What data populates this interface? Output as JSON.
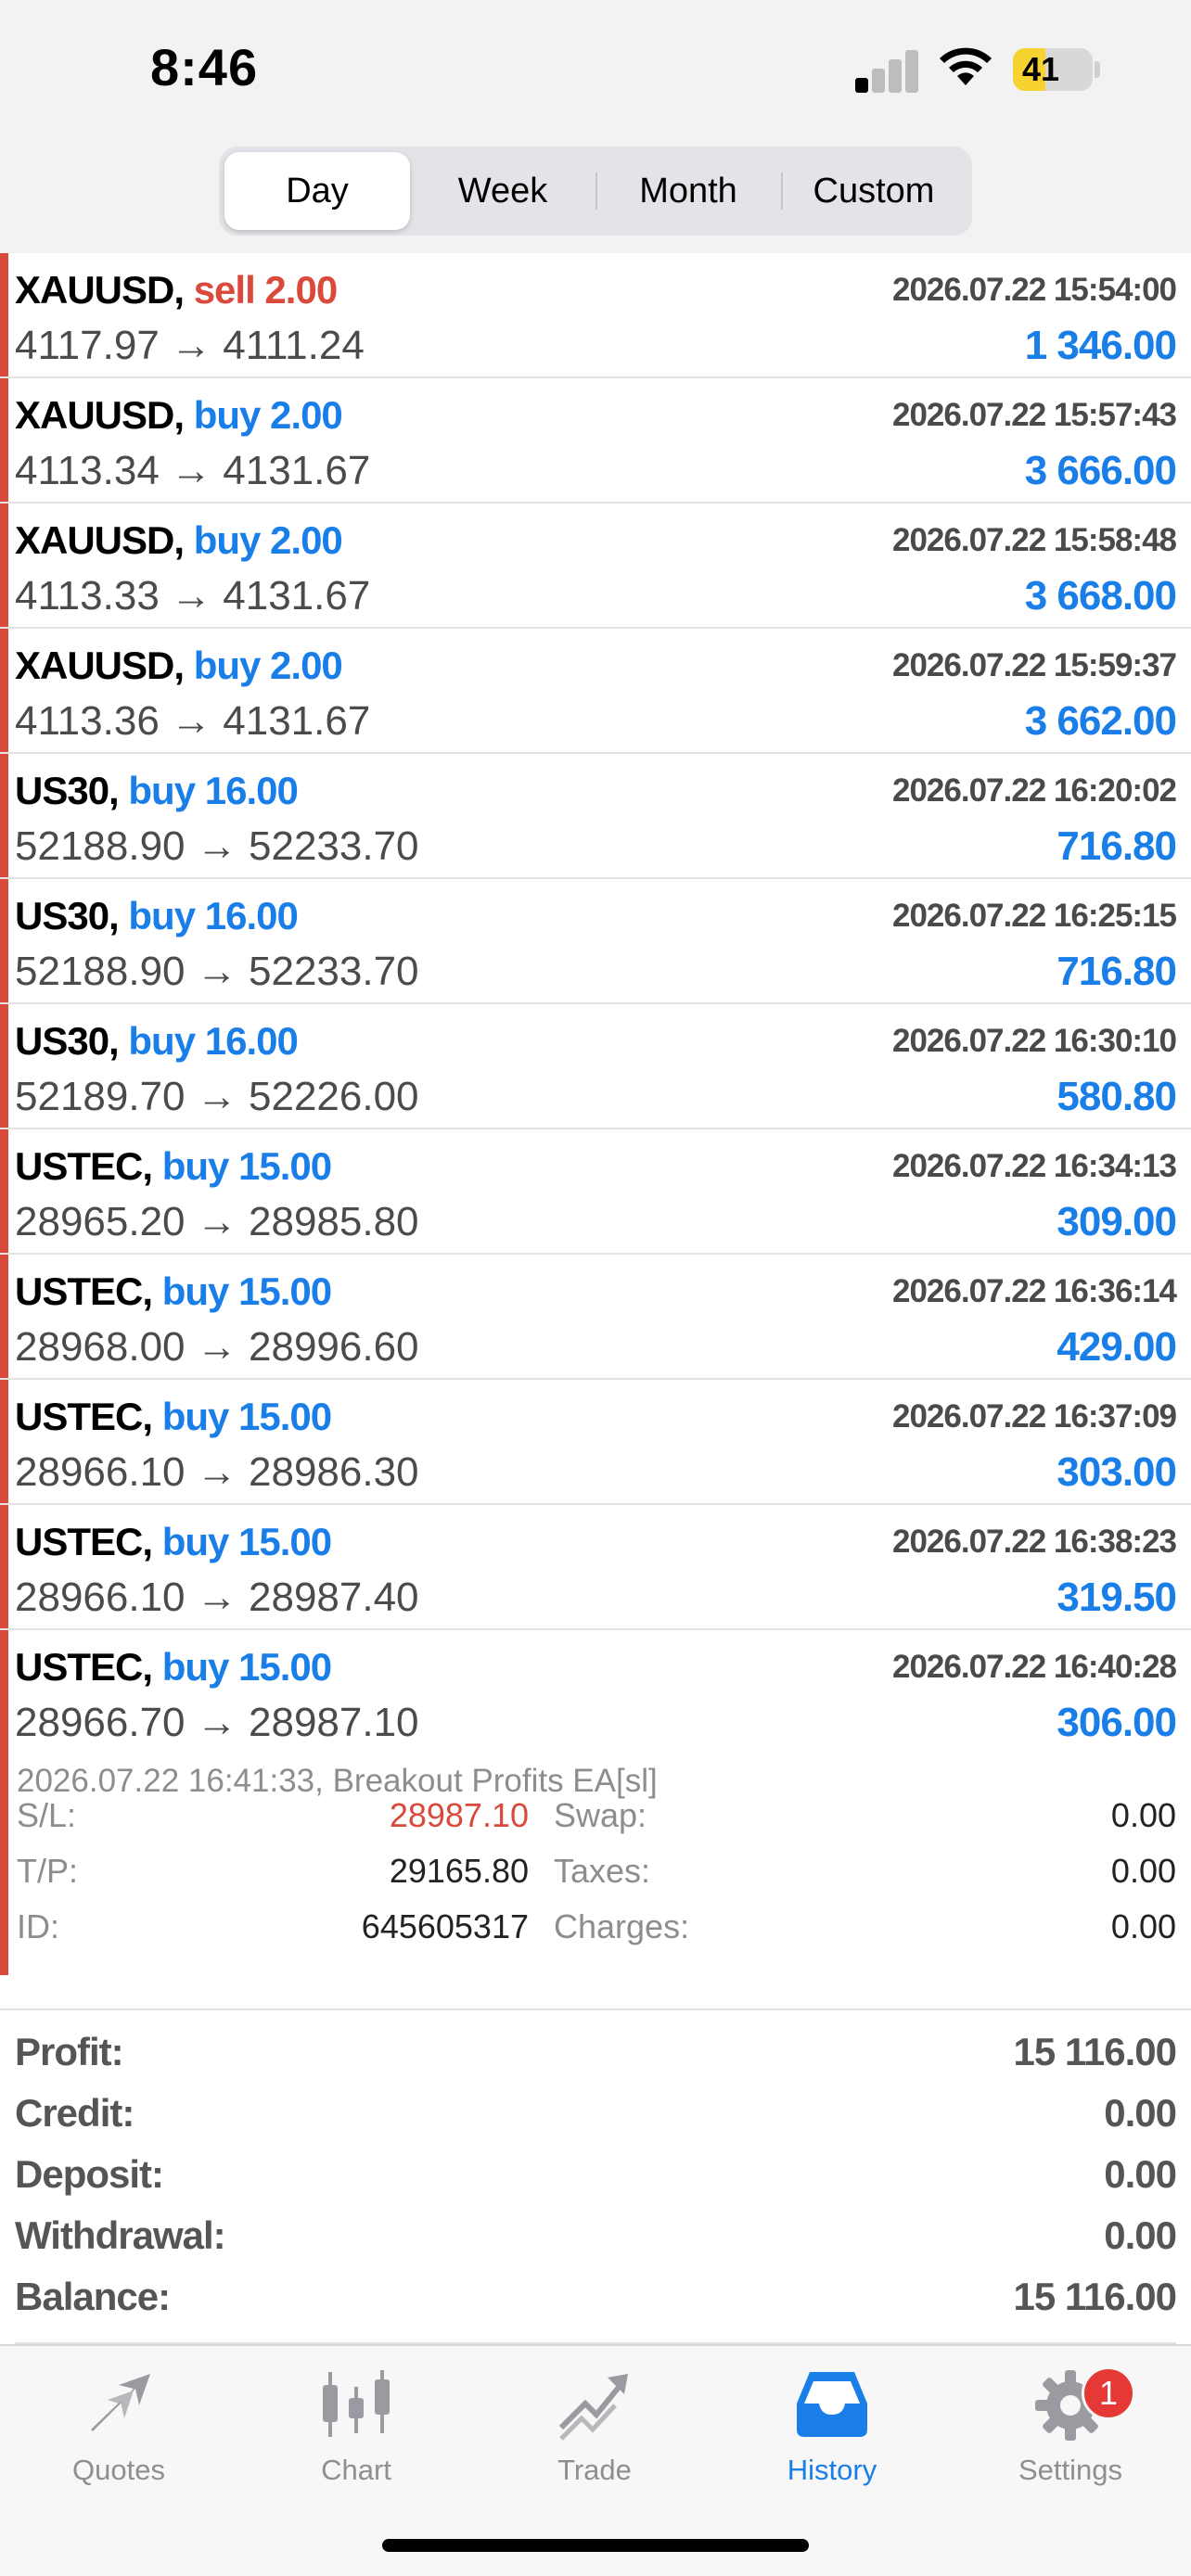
{
  "status_bar": {
    "time": "8:46",
    "battery_level": "41",
    "battery_fraction": 0.41,
    "signal_bars_active": 1,
    "signal_bars_total": 4
  },
  "period_tabs": [
    {
      "label": "Day",
      "active": true
    },
    {
      "label": "Week",
      "active": false
    },
    {
      "label": "Month",
      "active": false
    },
    {
      "label": "Custom",
      "active": false
    }
  ],
  "colors": {
    "buy": "#1a7ee8",
    "sell": "#d94a3c",
    "accent": "#1a7ee8",
    "badge": "#e53935"
  },
  "trades": [
    {
      "symbol": "XAUUSD,",
      "side": "sell 2.00",
      "side_type": "sell",
      "time": "2026.07.22 15:54:00",
      "open": "4117.97",
      "close": "4111.24",
      "profit": "1 346.00"
    },
    {
      "symbol": "XAUUSD,",
      "side": "buy 2.00",
      "side_type": "buy",
      "time": "2026.07.22 15:57:43",
      "open": "4113.34",
      "close": "4131.67",
      "profit": "3 666.00"
    },
    {
      "symbol": "XAUUSD,",
      "side": "buy 2.00",
      "side_type": "buy",
      "time": "2026.07.22 15:58:48",
      "open": "4113.33",
      "close": "4131.67",
      "profit": "3 668.00"
    },
    {
      "symbol": "XAUUSD,",
      "side": "buy 2.00",
      "side_type": "buy",
      "time": "2026.07.22 15:59:37",
      "open": "4113.36",
      "close": "4131.67",
      "profit": "3 662.00"
    },
    {
      "symbol": "US30,",
      "side": "buy 16.00",
      "side_type": "buy",
      "time": "2026.07.22 16:20:02",
      "open": "52188.90",
      "close": "52233.70",
      "profit": "716.80"
    },
    {
      "symbol": "US30,",
      "side": "buy 16.00",
      "side_type": "buy",
      "time": "2026.07.22 16:25:15",
      "open": "52188.90",
      "close": "52233.70",
      "profit": "716.80"
    },
    {
      "symbol": "US30,",
      "side": "buy 16.00",
      "side_type": "buy",
      "time": "2026.07.22 16:30:10",
      "open": "52189.70",
      "close": "52226.00",
      "profit": "580.80"
    },
    {
      "symbol": "USTEC,",
      "side": "buy 15.00",
      "side_type": "buy",
      "time": "2026.07.22 16:34:13",
      "open": "28965.20",
      "close": "28985.80",
      "profit": "309.00"
    },
    {
      "symbol": "USTEC,",
      "side": "buy 15.00",
      "side_type": "buy",
      "time": "2026.07.22 16:36:14",
      "open": "28968.00",
      "close": "28996.60",
      "profit": "429.00"
    },
    {
      "symbol": "USTEC,",
      "side": "buy 15.00",
      "side_type": "buy",
      "time": "2026.07.22 16:37:09",
      "open": "28966.10",
      "close": "28986.30",
      "profit": "303.00"
    },
    {
      "symbol": "USTEC,",
      "side": "buy 15.00",
      "side_type": "buy",
      "time": "2026.07.22 16:38:23",
      "open": "28966.10",
      "close": "28987.40",
      "profit": "319.50"
    },
    {
      "symbol": "USTEC,",
      "side": "buy 15.00",
      "side_type": "buy",
      "time": "2026.07.22 16:40:28",
      "open": "28966.70",
      "close": "28987.10",
      "profit": "306.00"
    }
  ],
  "arrow": "→",
  "expanded_detail": {
    "comment": "2026.07.22 16:41:33, Breakout Profits EA[sl]",
    "left": [
      {
        "label": "S/L:",
        "value": "28987.10",
        "highlight": true
      },
      {
        "label": "T/P:",
        "value": "29165.80",
        "highlight": false
      },
      {
        "label": "ID:",
        "value": "645605317",
        "highlight": false
      }
    ],
    "right": [
      {
        "label": "Swap:",
        "value": "0.00"
      },
      {
        "label": "Taxes:",
        "value": "0.00"
      },
      {
        "label": "Charges:",
        "value": "0.00"
      }
    ]
  },
  "summary": [
    {
      "label": "Profit:",
      "value": "15 116.00"
    },
    {
      "label": "Credit:",
      "value": "0.00"
    },
    {
      "label": "Deposit:",
      "value": "0.00"
    },
    {
      "label": "Withdrawal:",
      "value": "0.00"
    },
    {
      "label": "Balance:",
      "value": "15 116.00"
    }
  ],
  "tabbar": [
    {
      "label": "Quotes",
      "icon": "quotes-icon",
      "active": false
    },
    {
      "label": "Chart",
      "icon": "chart-icon",
      "active": false
    },
    {
      "label": "Trade",
      "icon": "trade-icon",
      "active": false
    },
    {
      "label": "History",
      "icon": "history-icon",
      "active": true
    },
    {
      "label": "Settings",
      "icon": "gear-icon",
      "active": false,
      "badge": "1"
    }
  ]
}
